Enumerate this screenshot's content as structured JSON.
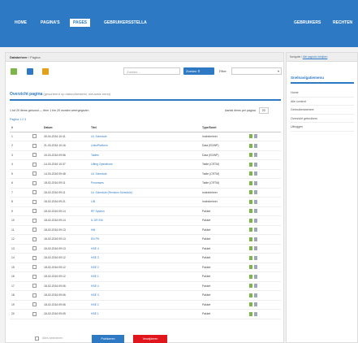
{
  "nav": {
    "items": [
      {
        "label": "HOME",
        "active": false
      },
      {
        "label": "PAGINA'S",
        "active": false
      },
      {
        "label": "PAGES",
        "active": true
      },
      {
        "label": "GEBRUIKERSSTELLA",
        "active": false
      }
    ],
    "right_items": [
      {
        "label": "GEBRUIKERS"
      },
      {
        "label": "RECHTEN"
      }
    ]
  },
  "breadcrumb": {
    "current": "Databeheer",
    "sep": "/",
    "rest": "Pagina"
  },
  "toolbar": {
    "search_placeholder": "Zoeken...",
    "search_label": "Zoeken",
    "filter_label": "Filter",
    "filter_value": ""
  },
  "list": {
    "title": "Overzicht pagina",
    "description": "(gesorteerd op datum/bewerkt, nieuwste eerst)",
    "count_text": "1 tot 20 items getoond — Item 1 t/m 20 worden weergegeven",
    "per_page_label": "Aantal items per pagina",
    "per_page_value": "20",
    "page_label": "Pagina 1 2 3",
    "columns": [
      "#",
      "",
      "Datum",
      "Titel",
      "Type/Soort",
      ""
    ],
    "rows": [
      {
        "n": "1",
        "date": "30-04-2016 10:41",
        "title": "Lit. Schedule",
        "type": "Indexbeheer"
      },
      {
        "n": "2",
        "date": "21-03-2016 10:16",
        "title": "LinksPlatform",
        "type": "Data (EDWP)"
      },
      {
        "n": "3",
        "date": "15-03-2016 09:56",
        "title": "Tables",
        "type": "Data (EDWP)"
      },
      {
        "n": "4",
        "date": "14-03-2016 10:37",
        "title": "Lifting Operations",
        "type": "Table (CRTM)"
      },
      {
        "n": "5",
        "date": "14-03-2016 09:48",
        "title": "Lit. Schedule",
        "type": "Table (CRTM)"
      },
      {
        "n": "6",
        "date": "18-02-2016 09:11",
        "title": "Processes",
        "type": "Table (CRTM)"
      },
      {
        "n": "7",
        "date": "18-02-2016 09:11",
        "title": "Lit. Schedule (Revision Schedule)",
        "type": "Indexbeheer"
      },
      {
        "n": "8",
        "date": "18-02-2016 09:21",
        "title": "LIB",
        "type": "Indexbeheer"
      },
      {
        "n": "9",
        "date": "18-02-2016 09:14",
        "title": "RF System",
        "type": "Pakket"
      },
      {
        "n": "10",
        "date": "18-02-2016 09:14",
        "title": "IL DR EM",
        "type": "Pakket"
      },
      {
        "n": "11",
        "date": "18-02-2016 09:13",
        "title": "HM",
        "type": "Pakket"
      },
      {
        "n": "12",
        "date": "18-02-2016 09:13",
        "title": "EN PH",
        "type": "Pakket"
      },
      {
        "n": "13",
        "date": "18-02-2016 09:13",
        "title": "HSE 4",
        "type": "Pakket"
      },
      {
        "n": "14",
        "date": "18-02-2016 09:12",
        "title": "HSE 3",
        "type": "Pakket"
      },
      {
        "n": "15",
        "date": "18-02-2016 09:12",
        "title": "HSE 2",
        "type": "Pakket"
      },
      {
        "n": "16",
        "date": "18-02-2016 09:12",
        "title": "HSE 1",
        "type": "Pakket"
      },
      {
        "n": "17",
        "date": "18-02-2016 09:06",
        "title": "HSE 4",
        "type": "Pakket"
      },
      {
        "n": "18",
        "date": "18-02-2016 09:06",
        "title": "HSE 3",
        "type": "Pakket"
      },
      {
        "n": "19",
        "date": "18-02-2016 09:06",
        "title": "HSE 2",
        "type": "Pakket"
      },
      {
        "n": "20",
        "date": "18-02-2016 09:05",
        "title": "HSE 1",
        "type": "Pakket"
      }
    ],
    "select_all_label": "Alles selecteren",
    "action_label": "Publiceren",
    "delete_label": "Verwijderen"
  },
  "sidebar": {
    "crumb_prefix": "Navigatie",
    "crumb_link": "Alle pagina's bekijken",
    "title": "Snelnavigatiemenu",
    "items": [
      "Home",
      "Alle content",
      "Gebruikersbeheer",
      "Overzicht gebruikers",
      "Uitloggen"
    ]
  },
  "colors": {
    "accent": "#2e79c4",
    "danger": "#e0161c",
    "edit_icon": "#7ab648"
  }
}
